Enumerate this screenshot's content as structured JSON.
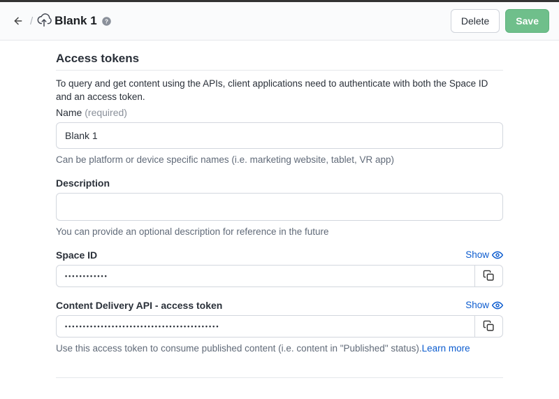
{
  "header": {
    "title": "Blank 1",
    "delete_label": "Delete",
    "save_label": "Save"
  },
  "page": {
    "title": "Access tokens",
    "intro": "To query and get content using the APIs, client applications need to authenticate with both the Space ID and an access token."
  },
  "name_field": {
    "label": "Name",
    "required": "(required)",
    "value": "Blank 1",
    "hint": "Can be platform or device specific names (i.e. marketing website, tablet, VR app)"
  },
  "description_field": {
    "label": "Description",
    "value": "",
    "hint": "You can provide an optional description for reference in the future"
  },
  "space_id_field": {
    "label": "Space ID",
    "show": "Show",
    "value": "••••••••••••"
  },
  "cda_field": {
    "label": "Content Delivery API - access token",
    "show": "Show",
    "value": "•••••••••••••••••••••••••••••••••••••••••••",
    "hint": "Use this access token to consume published content (i.e. content in \"Published\" status).",
    "learn_more": "Learn more"
  }
}
